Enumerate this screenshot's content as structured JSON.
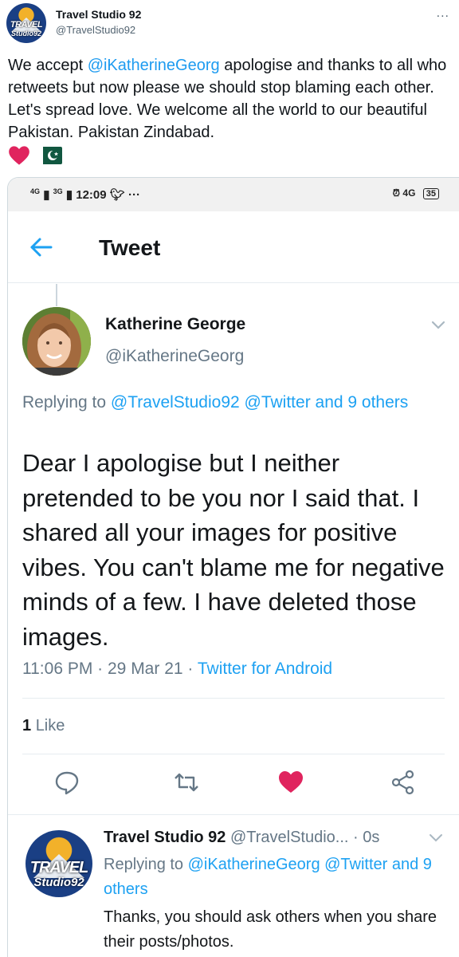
{
  "outer_tweet": {
    "avatar_logo_top": "TRAVEL",
    "avatar_logo_bottom": "Studio92",
    "display_name": "Travel Studio 92",
    "handle": "@TravelStudio92",
    "more": "...",
    "text_before_mention": "We accept ",
    "mention": "@iKatherineGeorg",
    "text_after_mention": " apologise and thanks to all who retweets but now please we should stop blaming each other. Let's spread love. We welcome all the world to our beautiful Pakistan. Pakistan Zindabad.",
    "emojis": [
      "red-heart",
      "pakistan-flag"
    ]
  },
  "screenshot": {
    "status_bar": {
      "left_signal_1": "4G",
      "left_signal_2": "3G",
      "time": "12:09",
      "extra": "···",
      "right_network": "4G",
      "battery": "35"
    },
    "app_bar": {
      "title": "Tweet"
    },
    "tweet": {
      "author_name": "Katherine George",
      "author_handle": "@iKatherineGeorg",
      "replying_prefix": "Replying to ",
      "replying_targets": "@TravelStudio92 @Twitter and 9 others",
      "body": "Dear I apologise but I neither pretended to be you nor I said that. I shared all your images for positive vibes. You can't blame me for negative minds of a few. I have deleted those images.",
      "time": "11:06 PM",
      "date": "29 Mar 21",
      "source": "Twitter for Android",
      "likes_count": "1",
      "likes_label": "Like"
    },
    "reply": {
      "avatar_logo_top": "TRAVEL",
      "avatar_logo_bottom": "Studio92",
      "author_name": "Travel Studio 92",
      "author_handle": "@TravelStudio...",
      "age": "0s",
      "replying_prefix": "Replying to ",
      "replying_targets": "@iKatherineGeorg @Twitter and 9 others",
      "body": "Thanks,  you should ask others when you share their posts/photos."
    },
    "colors": {
      "link_blue": "#1da1f2",
      "like_red": "#e0245e",
      "secondary_grey": "#657786"
    }
  }
}
